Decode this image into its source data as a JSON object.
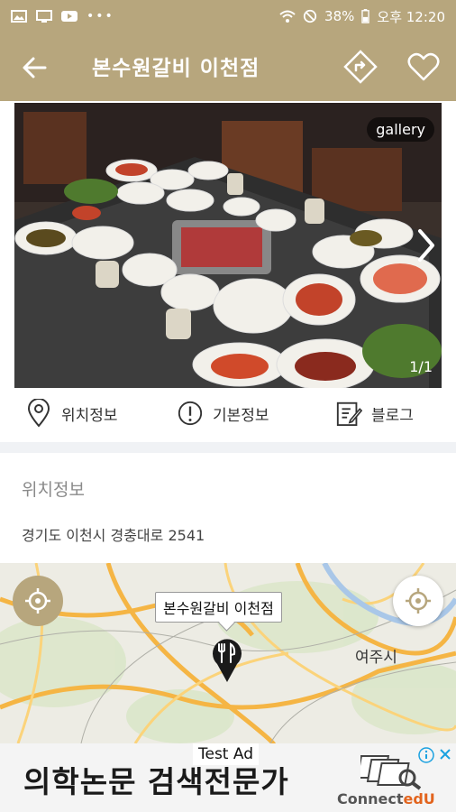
{
  "status_bar": {
    "battery": "38%",
    "time": "오후 12:20",
    "icons": [
      "gallery-icon",
      "cast-icon",
      "youtube-icon",
      "more-icon",
      "wifi-icon",
      "dnd-icon",
      "battery-icon"
    ]
  },
  "app_bar": {
    "title": "본수원갈비 이천점",
    "icons": [
      "back-arrow-icon",
      "directions-icon",
      "heart-icon"
    ]
  },
  "gallery": {
    "tag": "gallery",
    "counter": "1/1"
  },
  "tabs": [
    {
      "label": "위치정보",
      "icon": "location-pin-icon"
    },
    {
      "label": "기본정보",
      "icon": "info-icon"
    },
    {
      "label": "블로그",
      "icon": "blog-edit-icon"
    }
  ],
  "location": {
    "section_title": "위치정보",
    "address": "경기도 이천시 경충대로 2541"
  },
  "map": {
    "callout": "본수원갈비 이천점",
    "city_label": "여주시"
  },
  "ad": {
    "test_label": "Test Ad",
    "headline": "의학논문 검색전문가",
    "brand_prefix": "Connect",
    "brand_suffix": "edU"
  },
  "colors": {
    "accent": "#b7a67d"
  }
}
